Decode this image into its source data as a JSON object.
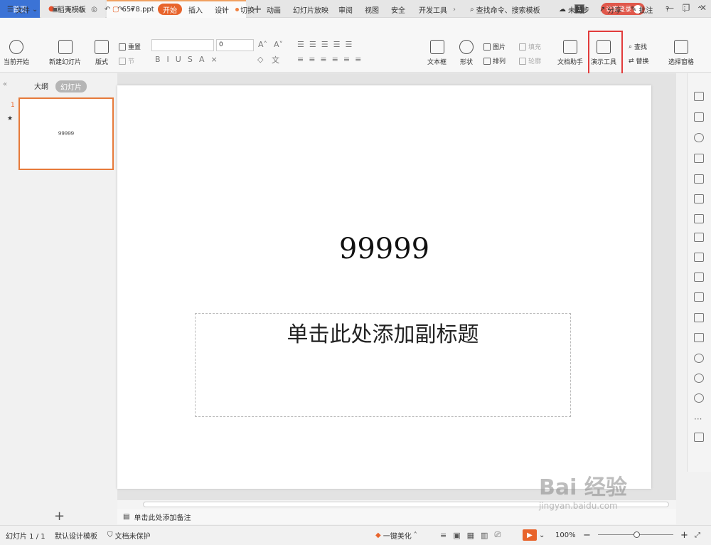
{
  "tabs": {
    "home": "首页",
    "template": "稻壳模板",
    "doc": "6578.ppt",
    "add": "+"
  },
  "title_right": {
    "badge": "1",
    "login": "访客登录"
  },
  "menu": {
    "file": "文件",
    "items": [
      "开始",
      "插入",
      "设计",
      "切换",
      "动画",
      "幻灯片放映",
      "审阅",
      "视图",
      "安全",
      "开发工具"
    ],
    "search": "查找命令、搜索模板",
    "sync": "未同步",
    "share": "分享",
    "annotate": "批注"
  },
  "ribbon": {
    "play_current": "当前开始",
    "new_slide": "新建幻灯片",
    "layout": "版式",
    "reset": "重置",
    "section": "节",
    "font_size": "0",
    "textbox": "文本框",
    "shape": "形状",
    "picture": "图片",
    "arrange": "排列",
    "fill": "填充",
    "outline": "轮廓",
    "doc_assistant": "文档助手",
    "presentation_tools": "演示工具",
    "find": "查找",
    "replace": "替换",
    "selection_pane": "选择窗格"
  },
  "panel": {
    "outline_tab": "大纲",
    "slides_tab": "幻灯片",
    "slide_number": "1",
    "thumb_text": "99999"
  },
  "slide": {
    "title": "99999",
    "subtitle": "单击此处添加副标题"
  },
  "notes": {
    "placeholder": "单击此处添加备注"
  },
  "status": {
    "slide_pos": "幻灯片 1 / 1",
    "template": "默认设计模板",
    "protection": "文档未保护",
    "beautify": "一键美化",
    "zoom": "100%"
  },
  "watermark": {
    "brand": "Bai  经验",
    "url": "jingyan.baidu.com"
  },
  "colors": {
    "accent": "#e8642c",
    "home_tab": "#3b73d6",
    "highlight": "#e23b3b"
  }
}
